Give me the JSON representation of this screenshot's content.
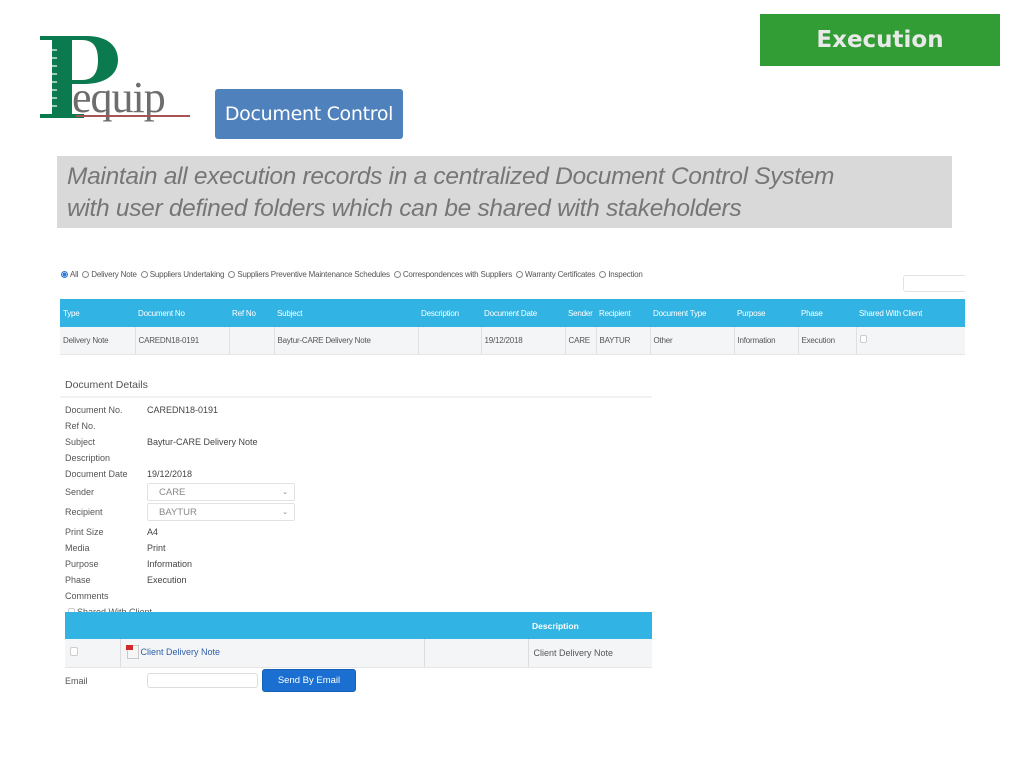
{
  "brand": {
    "logo_text": "Pequip",
    "colors": {
      "logo_green": "#0b7a4e",
      "logo_gray": "#6d6d6d",
      "logo_rule": "#a65454"
    }
  },
  "header": {
    "section_badge": "Document Control",
    "phase_badge": "Execution",
    "badge_colors": {
      "section": "#4f81bd",
      "phase": "#339d35"
    }
  },
  "tagline": {
    "line1": "Maintain all execution records in a centralized Document Control System",
    "line2": "with user defined folders which can be shared with stakeholders"
  },
  "filters": {
    "selected": "All",
    "options": [
      {
        "label": "All",
        "checked": true
      },
      {
        "label": "Delivery Note",
        "checked": false
      },
      {
        "label": "Suppliers Undertaking",
        "checked": false
      },
      {
        "label": "Suppliers Preventive Maintenance Schedules",
        "checked": false
      },
      {
        "label": "Correspondences with Suppliers",
        "checked": false
      },
      {
        "label": "Warranty Certificates",
        "checked": false
      },
      {
        "label": "Inspection",
        "checked": false
      }
    ],
    "search_value": ""
  },
  "documents_table": {
    "header_color": "#31b4e3",
    "columns": [
      "Type",
      "Document No",
      "Ref No",
      "Subject",
      "Description",
      "Document Date",
      "Sender",
      "Recipient",
      "Document Type",
      "Purpose",
      "Phase",
      "Shared With Client"
    ],
    "rows": [
      {
        "type": "Delivery Note",
        "document_no": "CAREDN18-0191",
        "ref_no": "",
        "subject": "Baytur-CARE Delivery Note",
        "description": "",
        "document_date": "19/12/2018",
        "sender": "CARE",
        "recipient": "BAYTUR",
        "document_type": "Other",
        "purpose": "Information",
        "phase": "Execution",
        "shared_with_client": false
      }
    ]
  },
  "details": {
    "title": "Document Details",
    "fields": {
      "document_no": {
        "label": "Document No.",
        "value": "CAREDN18-0191"
      },
      "ref_no": {
        "label": "Ref No.",
        "value": ""
      },
      "subject": {
        "label": "Subject",
        "value": "Baytur-CARE Delivery Note"
      },
      "description": {
        "label": "Description",
        "value": ""
      },
      "document_date": {
        "label": "Document Date",
        "value": "19/12/2018"
      },
      "sender": {
        "label": "Sender",
        "value": "CARE"
      },
      "recipient": {
        "label": "Recipient",
        "value": "BAYTUR"
      },
      "print_size": {
        "label": "Print Size",
        "value": "A4"
      },
      "media": {
        "label": "Media",
        "value": "Print"
      },
      "purpose": {
        "label": "Purpose",
        "value": "Information"
      },
      "phase": {
        "label": "Phase",
        "value": "Execution"
      },
      "comments": {
        "label": "Comments",
        "value": ""
      }
    },
    "shared_with_client": {
      "label": "Shared With Client",
      "checked": false
    }
  },
  "attachments": {
    "columns": [
      "",
      "",
      "",
      "Description"
    ],
    "rows": [
      {
        "selected": false,
        "file_name": "Client Delivery Note",
        "file_icon": "pdf-icon",
        "extra": "",
        "description": "Client Delivery Note"
      }
    ]
  },
  "email": {
    "label": "Email",
    "value": "",
    "send_button": "Send By Email"
  }
}
